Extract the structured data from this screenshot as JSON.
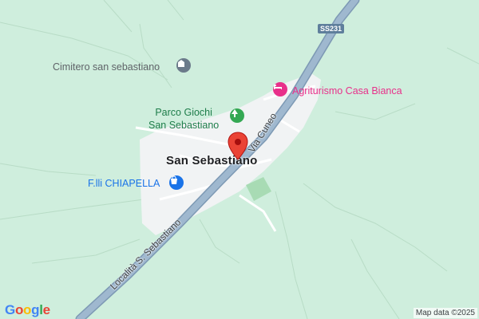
{
  "map": {
    "place_labels": {
      "cemetery": "Cimitero san sebastiano",
      "park": "Parco Giochi\nSan Sebastiano",
      "town": "San Sebastiano",
      "store": "F.lli CHIAPELLA",
      "hotel": "Agriturismo Casa Bianca"
    },
    "road_labels": {
      "via_cuneo": "Via Cuneo",
      "localita": "Località S. Sebastiano"
    },
    "route_shield": "SS231",
    "colors": {
      "background": "#cfeedd",
      "settlement": "#f1f3f4",
      "main_road": "#8fa9c2",
      "pin": "#ea4335",
      "park_green": "#34a853",
      "store_blue": "#1a73e8",
      "hotel_pink": "#e8308a"
    },
    "icons": {
      "cemetery": "cemetery-icon",
      "park": "tree-icon",
      "store": "shopping-bag-icon",
      "hotel": "bed-icon",
      "pin": "location-pin-icon"
    }
  },
  "footer": {
    "logo": "Google",
    "attribution": "Map data ©2025"
  }
}
